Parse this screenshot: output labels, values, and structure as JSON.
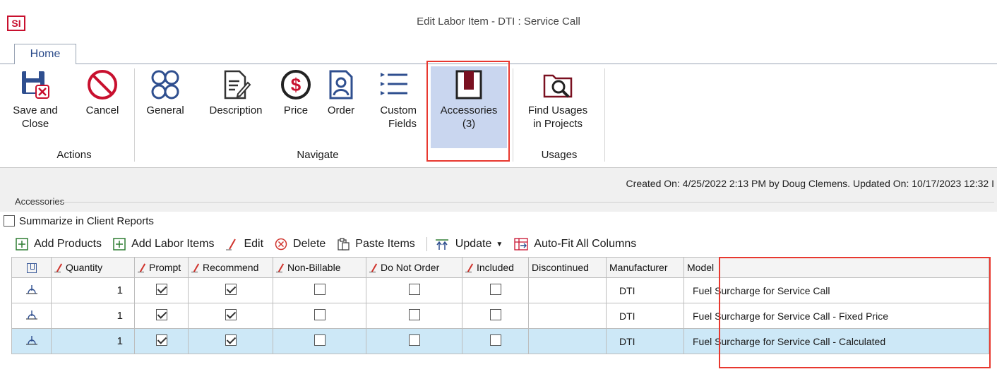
{
  "window": {
    "app_logo": "SI",
    "title": "Edit Labor Item - DTI : Service Call"
  },
  "tabs": [
    {
      "label": "Home"
    }
  ],
  "ribbon": {
    "actions": {
      "group": "Actions",
      "save": "Save and\nClose",
      "cancel": "Cancel"
    },
    "navigate": {
      "group": "Navigate",
      "general": "General",
      "description": "Description",
      "price": "Price",
      "order": "Order",
      "custom_fields": "Custom\nFields",
      "accessories": "Accessories\n(3)"
    },
    "usages": {
      "group": "Usages",
      "find_usages": "Find Usages\nin Projects"
    }
  },
  "created_info": "Created On: 4/25/2022 2:13 PM by Doug Clemens. Updated On: 10/17/2023 12:32 I",
  "accessories_section": {
    "label": "Accessories",
    "summarize_label": "Summarize in Client Reports",
    "summarize_checked": false
  },
  "toolbar": {
    "add_products": "Add Products",
    "add_labor": "Add Labor Items",
    "edit": "Edit",
    "delete": "Delete",
    "paste": "Paste Items",
    "update": "Update",
    "autofit": "Auto-Fit All Columns"
  },
  "grid": {
    "columns": [
      "",
      "Quantity",
      "Prompt",
      "Recommend",
      "Non-Billable",
      "Do Not Order",
      "Included",
      "Discontinued",
      "Manufacturer",
      "Model"
    ],
    "rows": [
      {
        "quantity": "1",
        "prompt": true,
        "recommend": true,
        "non_billable": false,
        "do_not_order": false,
        "included": false,
        "discontinued": "",
        "manufacturer": "DTI",
        "model": "Fuel Surcharge for Service Call"
      },
      {
        "quantity": "1",
        "prompt": true,
        "recommend": true,
        "non_billable": false,
        "do_not_order": false,
        "included": false,
        "discontinued": "",
        "manufacturer": "DTI",
        "model": "Fuel Surcharge for Service Call - Fixed Price"
      },
      {
        "quantity": "1",
        "prompt": true,
        "recommend": true,
        "non_billable": false,
        "do_not_order": false,
        "included": false,
        "discontinued": "",
        "manufacturer": "DTI",
        "model": "Fuel Surcharge for Service Call - Calculated"
      }
    ]
  },
  "colors": {
    "accent_blue": "#2f4f8f",
    "highlight_red": "#e8382f",
    "selected_row": "#cde8f7",
    "ribbon_selected": "#c9d6ef"
  }
}
